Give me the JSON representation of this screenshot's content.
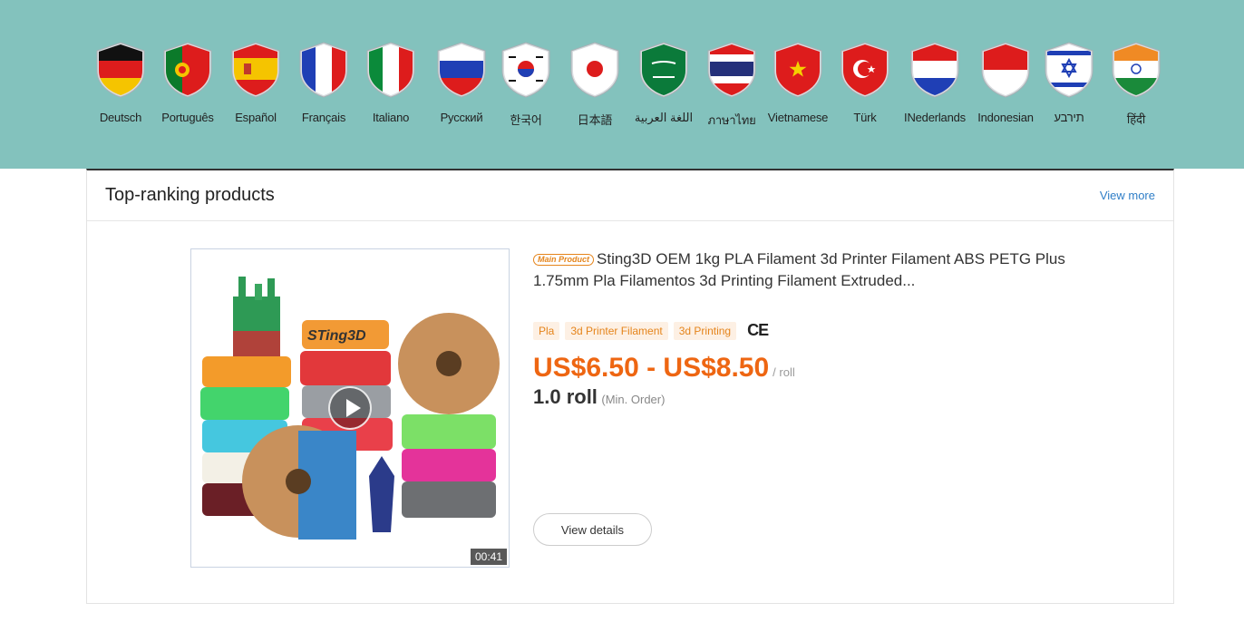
{
  "languages": [
    {
      "label": "Deutsch",
      "flag": "germany-flag-icon"
    },
    {
      "label": "Português",
      "flag": "portugal-flag-icon"
    },
    {
      "label": "Español",
      "flag": "spain-flag-icon"
    },
    {
      "label": "Français",
      "flag": "france-flag-icon"
    },
    {
      "label": "Italiano",
      "flag": "italy-flag-icon"
    },
    {
      "label": "Pусский",
      "flag": "russia-flag-icon"
    },
    {
      "label": "한국어",
      "flag": "korea-flag-icon"
    },
    {
      "label": "日本語",
      "flag": "japan-flag-icon"
    },
    {
      "label": "اللغة العربية",
      "flag": "saudi-arabia-flag-icon"
    },
    {
      "label": "ภาษาไทย",
      "flag": "thailand-flag-icon"
    },
    {
      "label": "Vietnamese",
      "flag": "vietnam-flag-icon"
    },
    {
      "label": "Türk",
      "flag": "turkey-flag-icon"
    },
    {
      "label": "INederlands",
      "flag": "netherlands-flag-icon"
    },
    {
      "label": "Indonesian",
      "flag": "indonesia-flag-icon"
    },
    {
      "label": "תירבע",
      "flag": "israel-flag-icon"
    },
    {
      "label": "हिंदी",
      "flag": "india-flag-icon"
    }
  ],
  "section": {
    "title": "Top-ranking products",
    "view_more": "View more"
  },
  "product": {
    "badge": "Main Product",
    "title": "Sting3D OEM 1kg PLA Filament 3d Printer Filament ABS PETG Plus 1.75mm Pla Filamentos 3d Printing Filament Extruded...",
    "tags": [
      "Pla",
      "3d Printer Filament",
      "3d Printing"
    ],
    "certification": "CE",
    "price": "US$6.50 - US$8.50",
    "price_unit": "/ roll",
    "moq": "1.0 roll",
    "moq_label": "(Min. Order)",
    "video_duration": "00:41",
    "image_brand_text": "STing3D",
    "view_details": "View details"
  },
  "colors": {
    "banner_bg": "#83c2bd",
    "price": "#ee6612",
    "tag_text": "#e5841b",
    "link": "#2f7ec7"
  }
}
